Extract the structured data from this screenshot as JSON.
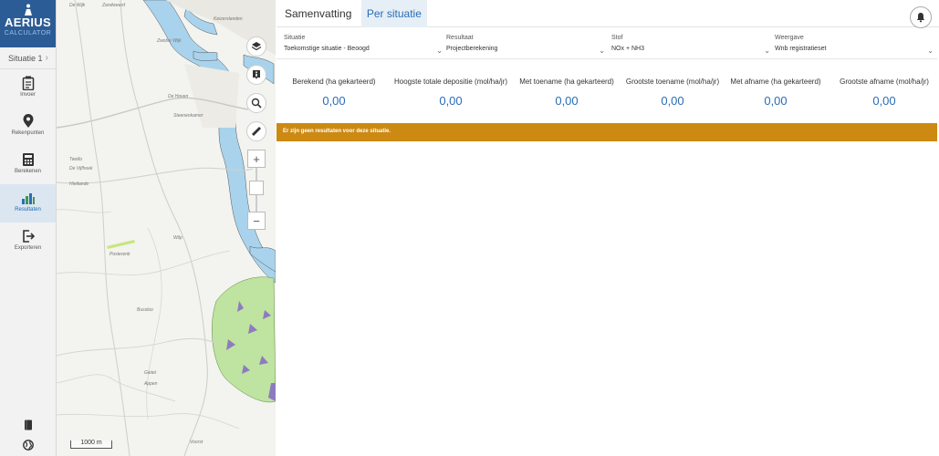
{
  "app": {
    "logo_title": "AERIUS",
    "logo_subtitle": "CALCULATOR"
  },
  "nav": {
    "situation_label": "Situatie 1",
    "items": [
      {
        "label": "Invoer",
        "icon": "clipboard-icon"
      },
      {
        "label": "Rekenpunten",
        "icon": "map-pin-icon"
      },
      {
        "label": "Berekenen",
        "icon": "calculator-icon"
      },
      {
        "label": "Resultaten",
        "icon": "bar-chart-icon",
        "active": true
      },
      {
        "label": "Exporteren",
        "icon": "export-icon"
      }
    ],
    "bottom": [
      {
        "icon": "book-icon"
      },
      {
        "icon": "globe-icon"
      }
    ]
  },
  "map": {
    "scale_label": "1000 m",
    "labels": [
      "De Wijk",
      "Zandweerd",
      "Keizerslanden",
      "Zwolse Wijk",
      "De Hoven",
      "Steenenkamer",
      "Twello",
      "De Vijfhoek",
      "Hietlande",
      "Posterenk",
      "Bussloo",
      "Wilp",
      "Gietel",
      "Appen",
      "Voorst"
    ]
  },
  "tabs": [
    {
      "label": "Samenvatting",
      "active": false
    },
    {
      "label": "Per situatie",
      "active": true
    }
  ],
  "filters": [
    {
      "label": "Situatie",
      "value": "Toekomstige situatie - Beoogd"
    },
    {
      "label": "Resultaat",
      "value": "Projectberekening"
    },
    {
      "label": "Stof",
      "value": "NOx + NH3"
    },
    {
      "label": "Weergave",
      "value": "Wnb registratieset"
    }
  ],
  "stats": [
    {
      "label": "Berekend (ha gekarteerd)",
      "value": "0,00"
    },
    {
      "label": "Hoogste totale depositie (mol/ha/jr)",
      "value": "0,00"
    },
    {
      "label": "Met toename (ha gekarteerd)",
      "value": "0,00"
    },
    {
      "label": "Grootste toename (mol/ha/jr)",
      "value": "0,00"
    },
    {
      "label": "Met afname (ha gekarteerd)",
      "value": "0,00"
    },
    {
      "label": "Grootste afname (mol/ha/jr)",
      "value": "0,00"
    }
  ],
  "alert": {
    "message": "Er zijn geen resultaten voor deze situatie."
  },
  "colors": {
    "brand": "#2c5c95",
    "accent": "#2a6db5",
    "alert": "#cc8a12",
    "water": "#a9d3ec",
    "nature": "#bfe3a0",
    "nature_dark": "#8e7bbf"
  }
}
